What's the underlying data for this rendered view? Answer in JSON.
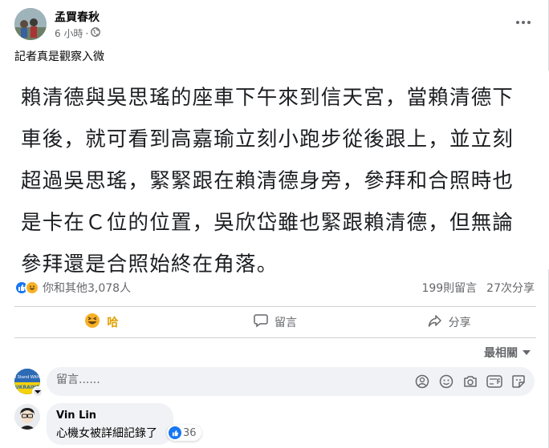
{
  "post": {
    "author": "孟買春秋",
    "time": "6 小時",
    "separator": "·",
    "privacy_icon": "globe-icon",
    "caption": "記者真是觀察入微",
    "image_text": "賴清德與吳思瑤的座車下午來到信天宮，當賴清德下車後，就可看到高嘉瑜立刻小跑步從後跟上，並立刻超過吳思瑤，緊緊跟在賴清德身旁，參拜和合照時也是卡在Ｃ位的位置，吳欣岱雖也緊跟賴清德，但無論參拜還是合照始終在角落。"
  },
  "stats": {
    "reactions_text": "你和其他3,078人",
    "comments": "199則留言",
    "shares": "27次分享"
  },
  "actions": {
    "haha": "哈",
    "comment": "留言",
    "share": "分享"
  },
  "sort_label": "最相關",
  "composer": {
    "placeholder": "留言......",
    "badge_lines": [
      "I Stand With",
      "UKRAINE"
    ]
  },
  "comments": [
    {
      "name": "Vin Lin",
      "text": "心機女被詳細記錄了",
      "reactions": "36"
    }
  ],
  "colors": {
    "like_blue": "#1877f2",
    "haha_yellow": "#f7b125",
    "secondary_text": "#65676b"
  }
}
